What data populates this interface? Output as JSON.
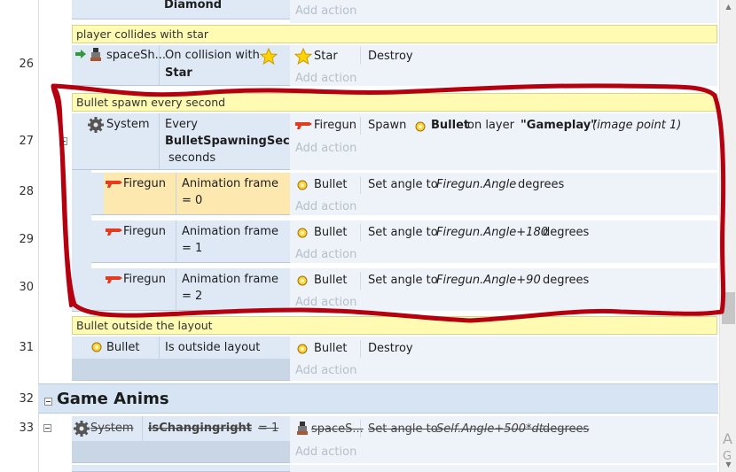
{
  "row_numbers": {
    "r26": "26",
    "r27": "27",
    "r28": "28",
    "r29": "29",
    "r30": "30",
    "r31": "31",
    "r32": "32",
    "r33": "33"
  },
  "add_action_label": "Add action",
  "top_event": {
    "condition_value": "Diamond"
  },
  "comments": {
    "c1": "player collides with star",
    "c2": "Bullet spawn every second",
    "c3": "Bullet outside the layout"
  },
  "event26": {
    "object": "spaceSh...",
    "condition_line1": "On collision with",
    "condition_line2": "Star",
    "action_object": "Star",
    "action_text": "Destroy"
  },
  "event27": {
    "object": "System",
    "condition_line1": "Every",
    "condition_line2": "BulletSpawningSecon",
    "condition_line3": "seconds",
    "action_object": "Firegun",
    "action_verb": "Spawn",
    "action_bold": "Bullet",
    "action_mid": "on layer",
    "action_layer": "\"Gameplay\"",
    "action_extra": "(image point 1)"
  },
  "sub_events": [
    {
      "object": "Firegun",
      "cond_line1": "Animation frame",
      "cond_line2": "= 0",
      "action_object": "Bullet",
      "action_pre": "Set angle to",
      "action_expr": "Firegun.Angle",
      "action_post": "degrees"
    },
    {
      "object": "Firegun",
      "cond_line1": "Animation frame",
      "cond_line2": "= 1",
      "action_object": "Bullet",
      "action_pre": "Set angle to",
      "action_expr": "Firegun.Angle+180",
      "action_post": "degrees"
    },
    {
      "object": "Firegun",
      "cond_line1": "Animation frame",
      "cond_line2": "= 2",
      "action_object": "Bullet",
      "action_pre": "Set angle to",
      "action_expr": "Firegun.Angle+90",
      "action_post": "degrees"
    }
  ],
  "event31": {
    "object": "Bullet",
    "condition": "Is outside layout",
    "action_object": "Bullet",
    "action_text": "Destroy"
  },
  "group": {
    "title": "Game Anims"
  },
  "event33": {
    "object": "System",
    "condition_bold": "isChangingright",
    "condition_rest": "= 1",
    "action_object": "spaceS...",
    "action_pre": "Set angle to",
    "action_expr": "Self.Angle+500*dt",
    "action_post": "degrees"
  },
  "watermark": {
    "line1": "A",
    "line2": "G"
  },
  "colors": {
    "annotation_stroke": "#b5000f",
    "highlight": "#fde9b0",
    "comment_bg": "#fffbb2",
    "event_bg": "#dfe9f5"
  }
}
